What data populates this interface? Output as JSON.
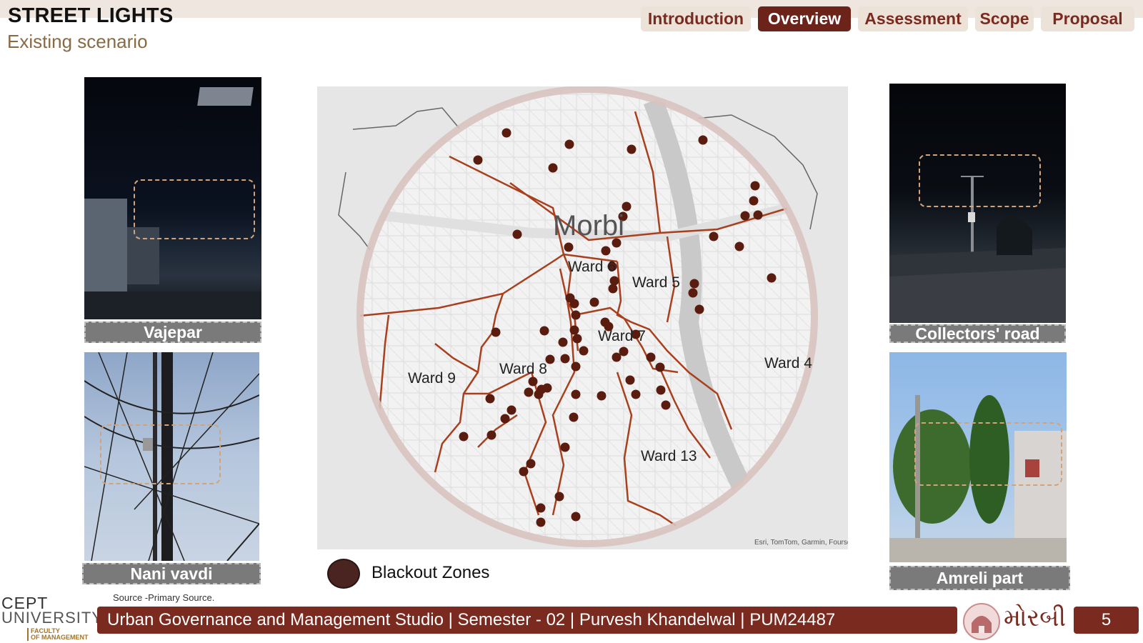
{
  "header": {
    "title": "STREET LIGHTS",
    "subtitle": "Existing scenario"
  },
  "nav": {
    "items": [
      {
        "label": "Introduction",
        "active": false
      },
      {
        "label": "Overview",
        "active": true
      },
      {
        "label": "Assessment",
        "active": false
      },
      {
        "label": "Scope",
        "active": false
      },
      {
        "label": "Proposal",
        "active": false
      }
    ]
  },
  "photos": {
    "vajepar": "Vajepar",
    "nani_vavdi": "Nani vavdi",
    "collectors_road": "Collectors' road",
    "amreli_part": "Amreli part"
  },
  "map": {
    "city_label": "Morbi",
    "ward_labels": [
      "Ward 6",
      "Ward 5",
      "Ward 7",
      "Ward 8",
      "Ward 9",
      "Ward 4",
      "Ward 13"
    ],
    "attribution": "Esri, TomTom, Garmin, Foursquar"
  },
  "legend": {
    "label": "Blackout Zones"
  },
  "footer": {
    "source": "Source -Primary Source.",
    "studio_text": "Urban Governance and Management Studio | Semester - 02 | Purvesh Khandelwal | PUM24487",
    "page_number": "5",
    "university_line1": "CEPT",
    "university_line2": "UNIVERSITY",
    "faculty_line1": "FACULTY",
    "faculty_line2": "OF MANAGEMENT",
    "city_logo_text": "મોરબી"
  },
  "colors": {
    "accent": "#7a2a1e",
    "active_nav": "#6b231a",
    "blackout_dot": "#5a1c0e"
  }
}
